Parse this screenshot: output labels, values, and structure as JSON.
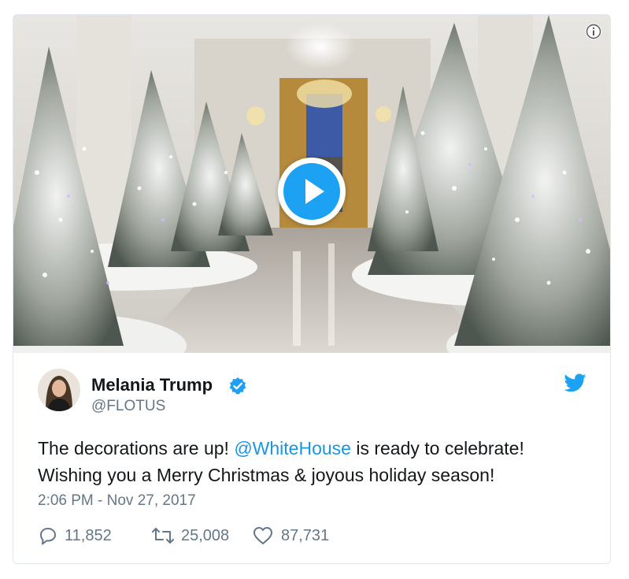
{
  "tweet": {
    "author_name": "Melania Trump",
    "author_handle": "@FLOTUS",
    "text_part1": "The decorations are up! ",
    "mention": "@WhiteHouse",
    "text_part2": " is ready to celebrate!",
    "text_line2": "Wishing you a Merry Christmas & joyous holiday season!",
    "timestamp": "2:06 PM - Nov 27, 2017"
  },
  "actions": {
    "replies": "11,852",
    "retweets": "25,008",
    "likes": "87,731"
  },
  "media": {
    "type": "video",
    "description_icon": "play-icon"
  },
  "colors": {
    "accent": "#1da1f2",
    "link": "#1b95e0",
    "muted": "#657786",
    "text": "#14171a",
    "border": "#e1e8ed"
  },
  "icons": {
    "info": "info-icon",
    "verified": "verified-badge-icon",
    "brand": "twitter-bird-icon",
    "reply": "reply-icon",
    "retweet": "retweet-icon",
    "like": "heart-icon"
  }
}
